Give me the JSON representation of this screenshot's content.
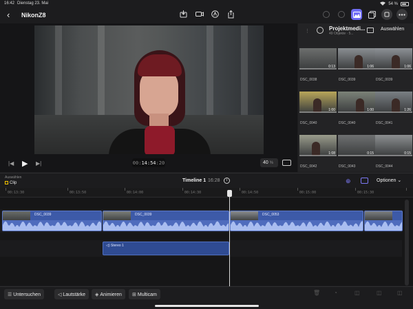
{
  "status": {
    "time": "16:42",
    "date": "Dienstag 23. Mai",
    "battery": "54 %"
  },
  "toolbar": {
    "title": "NikonZ8",
    "back_glyph": "‹",
    "center_icons": [
      "import-icon",
      "camera-icon",
      "voiceover-icon",
      "share-icon"
    ],
    "right_icons": [
      "undo-icon",
      "redo-icon",
      "photos-icon",
      "library-add-icon",
      "more-options-icon",
      "ellipsis-icon"
    ]
  },
  "viewer": {
    "timecode_prefix": "00:",
    "timecode_main": "14:54",
    "timecode_frames": ":20",
    "zoom_value": "40",
    "zoom_unit": "%"
  },
  "browser": {
    "title": "Projektmedi...",
    "subtitle": "49 Objekte · 5...",
    "select_label": "Auswählen",
    "clips": [
      {
        "name": "DSC_0038",
        "duration": "0:13",
        "tone": "#6d6f6e"
      },
      {
        "name": "DSC_0039",
        "duration": "1:06",
        "tone": "#8a8e92"
      },
      {
        "name": "DSC_0039",
        "duration": "1:06",
        "tone": "#8d9196"
      },
      {
        "name": "DSC_0040",
        "duration": "1:00",
        "tone": "#b8a65a"
      },
      {
        "name": "DSC_0040",
        "duration": "1:00",
        "tone": "#7c8278"
      },
      {
        "name": "DSC_0041",
        "duration": "1:26",
        "tone": "#7a7f84"
      },
      {
        "name": "DSC_0042",
        "duration": "1:08",
        "tone": "#9a9c8c"
      },
      {
        "name": "DSC_0043",
        "duration": "0:15",
        "tone": "#6e7071"
      },
      {
        "name": "DSC_0044",
        "duration": "0:15",
        "tone": "#8c8f91"
      }
    ]
  },
  "timeline": {
    "selection_label": "Auswählen",
    "selection_value": "Clip",
    "name": "Timeline 1",
    "duration": "16:28",
    "info_glyph": "i",
    "options_label": "Optionen",
    "ruler_ticks": [
      "00:13:30",
      "00:13:50",
      "00:14:00",
      "00:14:30",
      "00:14:50",
      "00:15:00",
      "00:15:30",
      "00:15:50"
    ],
    "video_clips": [
      {
        "name": "DSC_0039",
        "tone": "#6a6d6a"
      },
      {
        "name": "DSC_0039",
        "tone": "#7c7f7a"
      },
      {
        "name": "DSC_0053",
        "tone": "#8a8d8f"
      },
      {
        "name": "",
        "tone": "#7d8082"
      }
    ],
    "audio_clip": {
      "name": "Stereo 1"
    }
  },
  "bottom_bar": {
    "inspect": "Untersuchen",
    "volume": "Lautstärke",
    "animate": "Animieren",
    "multicam": "Multicam"
  },
  "colors": {
    "accent": "#6f6cf5",
    "clip_blue": "#3d5aa8",
    "selection_yellow": "#f5c400"
  }
}
